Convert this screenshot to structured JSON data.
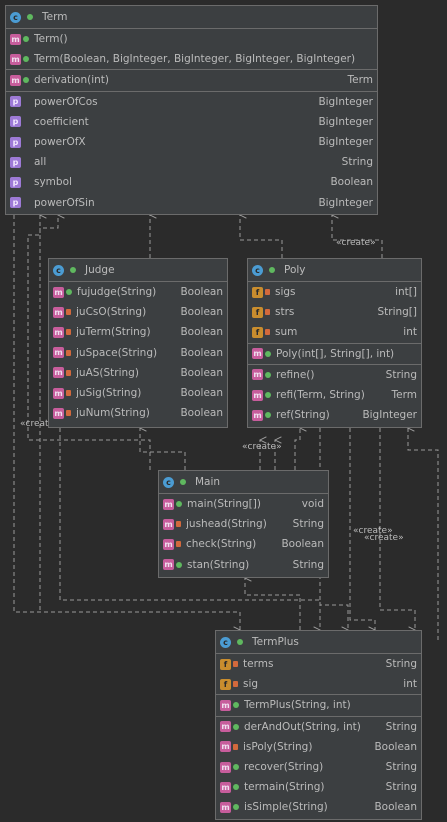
{
  "classes": {
    "term": {
      "name": "Term",
      "icon": "class-icon",
      "constructors": [
        {
          "name": "Term()",
          "type": ""
        },
        {
          "name": "Term(Boolean, BigInteger, BigInteger, BigInteger, BigInteger)",
          "type": ""
        }
      ],
      "methods": [
        {
          "name": "derivation(int)",
          "type": "Term"
        }
      ],
      "properties": [
        {
          "name": "powerOfCos",
          "type": "BigInteger"
        },
        {
          "name": "coefficient",
          "type": "BigInteger"
        },
        {
          "name": "powerOfX",
          "type": "BigInteger"
        },
        {
          "name": "all",
          "type": "String"
        },
        {
          "name": "symbol",
          "type": "Boolean"
        },
        {
          "name": "powerOfSin",
          "type": "BigInteger"
        }
      ]
    },
    "judge": {
      "name": "Judge",
      "methods": [
        {
          "name": "fujudge(String)",
          "type": "Boolean",
          "vis": "pub"
        },
        {
          "name": "juCsO(String)",
          "type": "Boolean",
          "vis": "priv"
        },
        {
          "name": "juTerm(String)",
          "type": "Boolean",
          "vis": "priv"
        },
        {
          "name": "juSpace(String)",
          "type": "Boolean",
          "vis": "priv"
        },
        {
          "name": "juAS(String)",
          "type": "Boolean",
          "vis": "priv"
        },
        {
          "name": "juSig(String)",
          "type": "Boolean",
          "vis": "priv"
        },
        {
          "name": "juNum(String)",
          "type": "Boolean",
          "vis": "priv"
        }
      ]
    },
    "poly": {
      "name": "Poly",
      "fields": [
        {
          "name": "sigs",
          "type": "int[]"
        },
        {
          "name": "strs",
          "type": "String[]"
        },
        {
          "name": "sum",
          "type": "int"
        }
      ],
      "constructors": [
        {
          "name": "Poly(int[], String[], int)",
          "type": ""
        }
      ],
      "methods": [
        {
          "name": "refine()",
          "type": "String"
        },
        {
          "name": "refi(Term, String)",
          "type": "Term"
        },
        {
          "name": "ref(String)",
          "type": "BigInteger"
        }
      ]
    },
    "main": {
      "name": "Main",
      "methods": [
        {
          "name": "main(String[])",
          "type": "void",
          "vis": "pub"
        },
        {
          "name": "jushead(String)",
          "type": "String",
          "vis": "priv"
        },
        {
          "name": "check(String)",
          "type": "Boolean",
          "vis": "priv"
        },
        {
          "name": "stan(String)",
          "type": "String",
          "vis": "pub"
        }
      ]
    },
    "termplus": {
      "name": "TermPlus",
      "fields": [
        {
          "name": "terms",
          "type": "String"
        },
        {
          "name": "sig",
          "type": "int"
        }
      ],
      "constructors": [
        {
          "name": "TermPlus(String, int)",
          "type": ""
        }
      ],
      "methods": [
        {
          "name": "derAndOut(String, int)",
          "type": "String",
          "vis": "pub"
        },
        {
          "name": "isPoly(String)",
          "type": "Boolean",
          "vis": "priv"
        },
        {
          "name": "recover(String)",
          "type": "String",
          "vis": "pub"
        },
        {
          "name": "termain(String)",
          "type": "String",
          "vis": "pub"
        },
        {
          "name": "isSimple(String)",
          "type": "Boolean",
          "vis": "pub"
        }
      ]
    }
  },
  "labels": {
    "create_1": "«create»",
    "create_2": "«create»",
    "create_3": "«create»",
    "create_4": "«create»",
    "create_5": "«create»"
  },
  "colors": {
    "background": "#2b2b2b",
    "node": "#3c3f41",
    "edge": "#9a9a9a"
  }
}
